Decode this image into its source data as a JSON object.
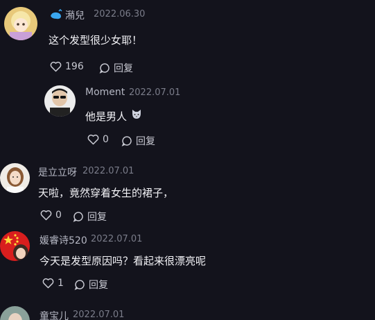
{
  "comments": [
    {
      "username": "潲兒",
      "date": "2022.06.30",
      "text": "这个发型很少女耶！",
      "likes": "196",
      "reply_label": "回复",
      "badge_icon": "whale-icon"
    },
    {
      "username": "Moment",
      "date": "2022.07.01",
      "text": "他是男人",
      "emoji": "cat-face-icon",
      "likes": "0",
      "reply_label": "回复"
    },
    {
      "username": "是立立呀",
      "date": "2022.07.01",
      "text": "天啦，竟然穿着女生的裙子，",
      "likes": "0",
      "reply_label": "回复"
    },
    {
      "username": "媛睿诗520",
      "date": "2022.07.01",
      "text": "今天是发型原因吗？看起来很漂亮呢",
      "likes": "1",
      "reply_label": "回复"
    },
    {
      "username": "童宝儿",
      "date": "2022.07.01"
    }
  ],
  "colors": {
    "background": "#13131c",
    "username": "#b5b7c3",
    "date": "#7b7d8a",
    "text": "#f2f2f6",
    "badge": "#3aa7f0"
  }
}
